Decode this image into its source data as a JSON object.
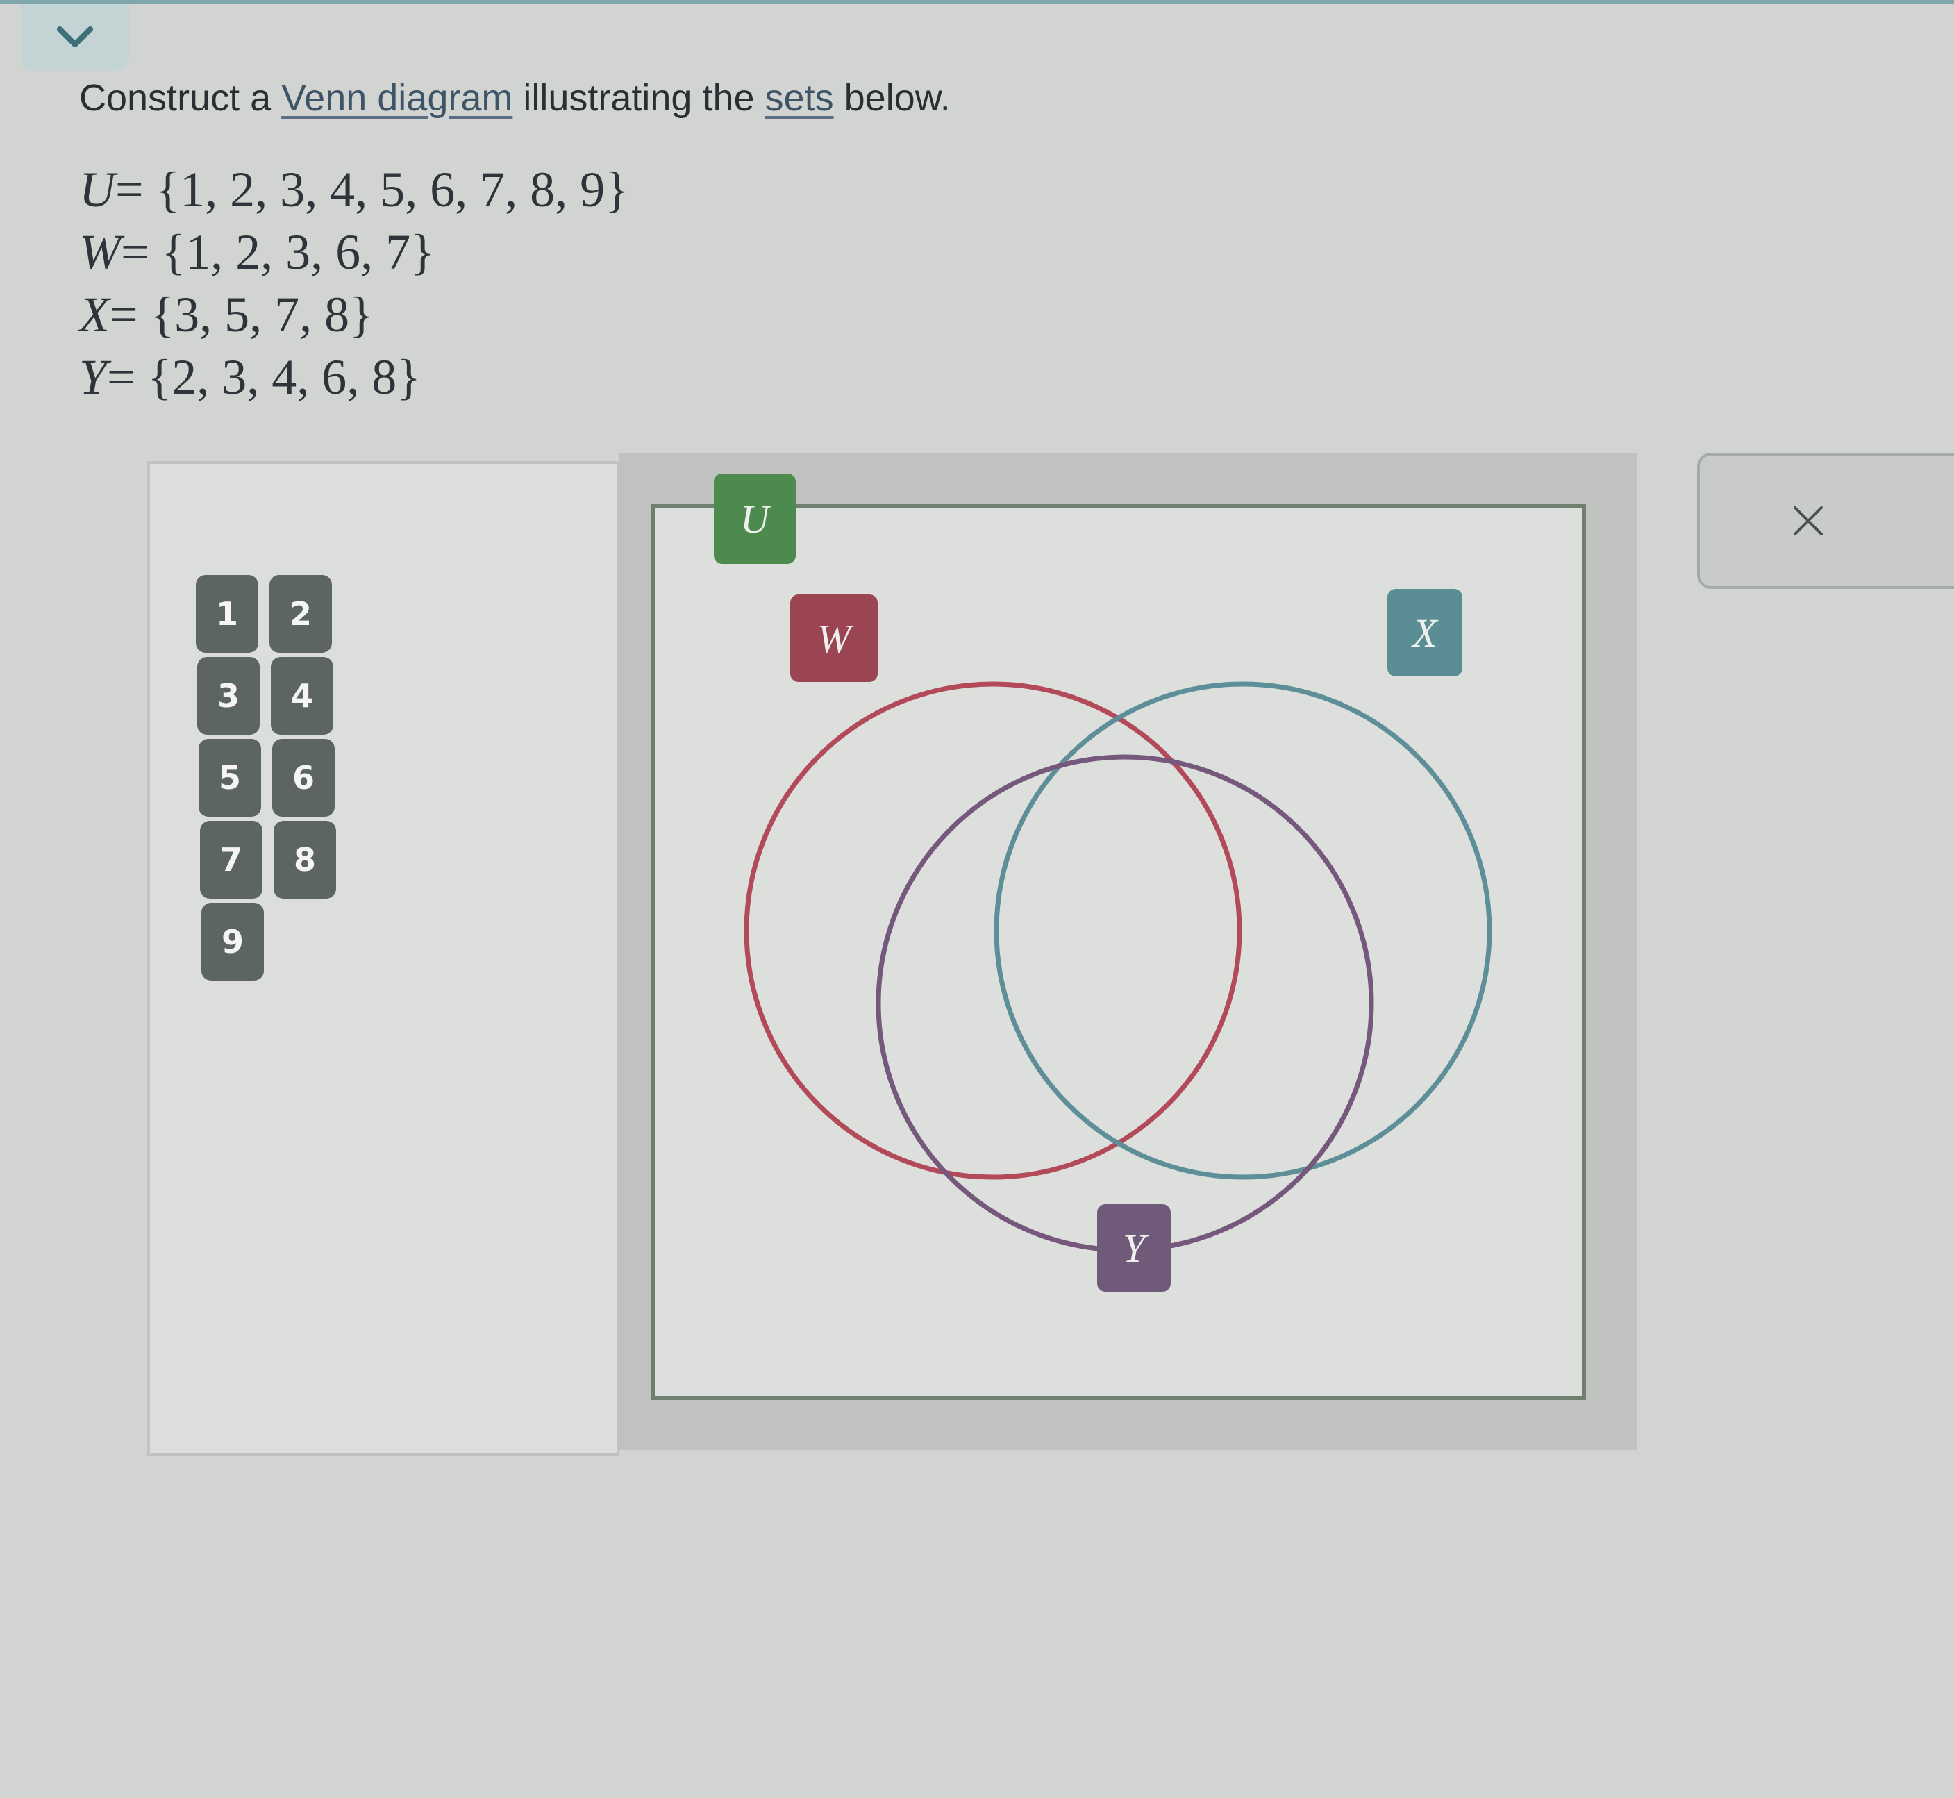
{
  "instruction": {
    "prefix": "Construct a ",
    "link1": "Venn diagram",
    "middle": " illustrating the ",
    "link2": "sets",
    "suffix": " below."
  },
  "sets": [
    {
      "var": "U",
      "rest": "= {1, 2, 3, 4, 5, 6, 7, 8, 9}"
    },
    {
      "var": "W",
      "rest": "= {1, 2, 3, 6, 7}"
    },
    {
      "var": "X",
      "rest": "= {3, 5, 7, 8}"
    },
    {
      "var": "Y",
      "rest": "= {2, 3, 4, 6, 8}"
    }
  ],
  "tiles": [
    "1",
    "2",
    "3",
    "4",
    "5",
    "6",
    "7",
    "8",
    "9"
  ],
  "labels": {
    "u": "U",
    "w": "W",
    "x": "X",
    "y": "Y"
  },
  "colors": {
    "w": "#b24a5a",
    "x": "#5e8f98",
    "y": "#75587c",
    "universe": "#4d8a4d"
  },
  "icons": {
    "collapse": "chevron-down-icon",
    "close": "close-icon"
  }
}
